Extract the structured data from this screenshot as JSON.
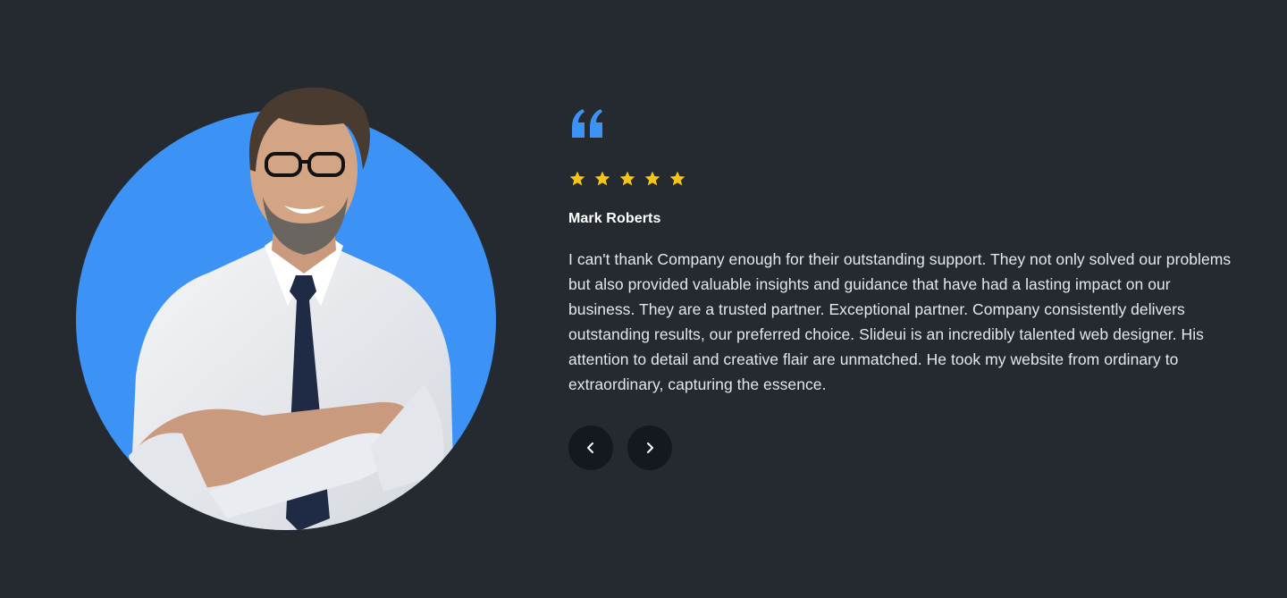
{
  "testimonial": {
    "photo_alt": "Smiling man with glasses and beard in white shirt and navy tie, arms crossed",
    "quote_icon": "quote-icon",
    "rating": 5,
    "rating_max": 5,
    "name": "Mark Roberts",
    "text": "I can't thank Company enough for their outstanding support. They not only solved our problems but also provided valuable insights and guidance that have had a lasting impact on our business. They are a trusted partner. Exceptional partner. Company consistently delivers outstanding results, our preferred choice. Slideui is an incredibly talented web designer. His attention to detail and creative flair are unmatched. He took my website from ordinary to extraordinary, capturing the essence."
  },
  "nav": {
    "prev_icon": "chevron-left-icon",
    "next_icon": "chevron-right-icon"
  },
  "colors": {
    "background": "#252a31",
    "accent": "#3d93f5",
    "star": "#f5c518",
    "button": "#141920"
  }
}
